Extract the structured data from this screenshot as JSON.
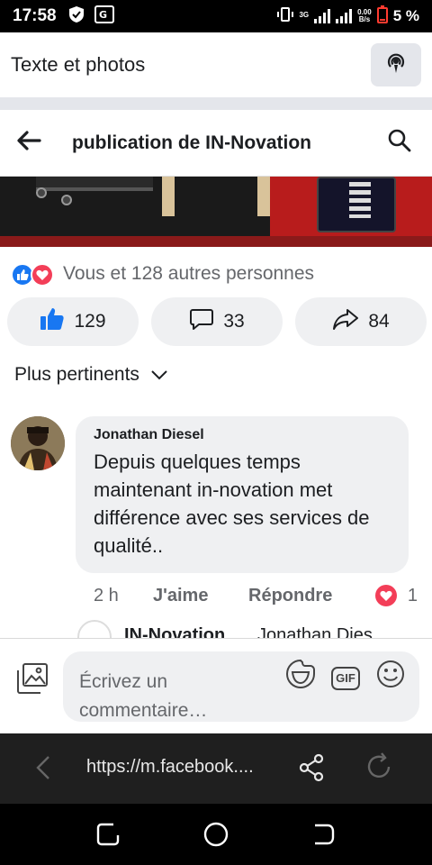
{
  "status_bar": {
    "time": "17:58",
    "network_type": "3G",
    "net_speed_value": "0.00",
    "net_speed_unit": "B/s",
    "battery_percent": "5 %"
  },
  "top_bar": {
    "title": "Texte et photos",
    "live_icon": "podcast-icon"
  },
  "header": {
    "title": "publication de IN-Novation",
    "back_icon": "arrow-left-icon",
    "search_icon": "search-icon"
  },
  "reactions": {
    "summary": "Vous et 128 autres personnes",
    "types": [
      "like",
      "love"
    ]
  },
  "actions": {
    "like_count": "129",
    "comment_count": "33",
    "share_count": "84"
  },
  "sort": {
    "label": "Plus pertinents"
  },
  "comment": {
    "author": "Jonathan Diesel",
    "text": "Depuis quelques temps maintenant in-novation met différence avec ses services de qualité..",
    "time": "2 h",
    "like_label": "J'aime",
    "reply_label": "Répondre",
    "reaction_count": "1"
  },
  "reply_preview": {
    "author": "IN-Novation",
    "mention": "Jonathan Dies"
  },
  "composer": {
    "placeholder": "Écrivez un commentaire…",
    "gif_label": "GIF"
  },
  "browser": {
    "url": "https://m.facebook...."
  },
  "colors": {
    "accent": "#1877f2",
    "love": "#f33e58",
    "pill_bg": "#eff0f2",
    "secondary_text": "#65676b"
  }
}
